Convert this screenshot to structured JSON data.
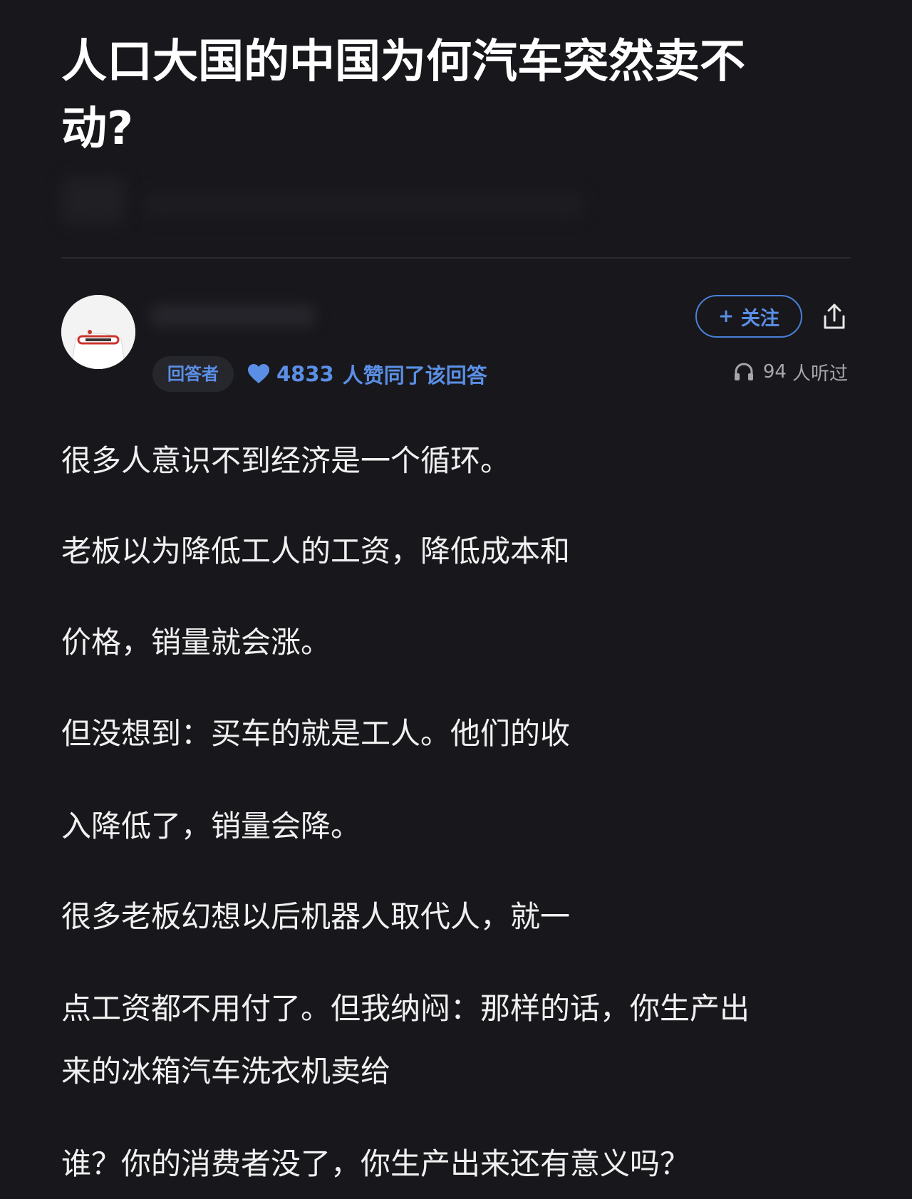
{
  "question": {
    "title": "人口大国的中国为何汽车突然卖不动?"
  },
  "author": {
    "role_badge": "回答者",
    "likes_count": "4833",
    "likes_suffix": "人赞同了该回答",
    "follow_label": "关注",
    "listen_count": "94",
    "listen_suffix": "人听过"
  },
  "answer": {
    "lines": [
      "很多人意识不到经济是一个循环。",
      "老板以为降低工人的工资，降低成本和",
      "价格，销量就会涨。",
      "但没想到：买车的就是工人。他们的收",
      "入降低了，销量会降。",
      "很多老板幻想以后机器人取代人，就一",
      "点工资都不用付了。但我纳闷：那样的话，你生产出",
      "来的冰箱汽车洗衣机卖给",
      "谁？你的消费者没了，你生产出来还有意义吗？"
    ]
  },
  "colors": {
    "background": "#18181c",
    "accent": "#5b8fe6",
    "text": "#f0f0f0",
    "muted": "#a6a6ac"
  },
  "icons": [
    "plus-icon",
    "share-icon",
    "heart-icon",
    "headphones-icon"
  ]
}
